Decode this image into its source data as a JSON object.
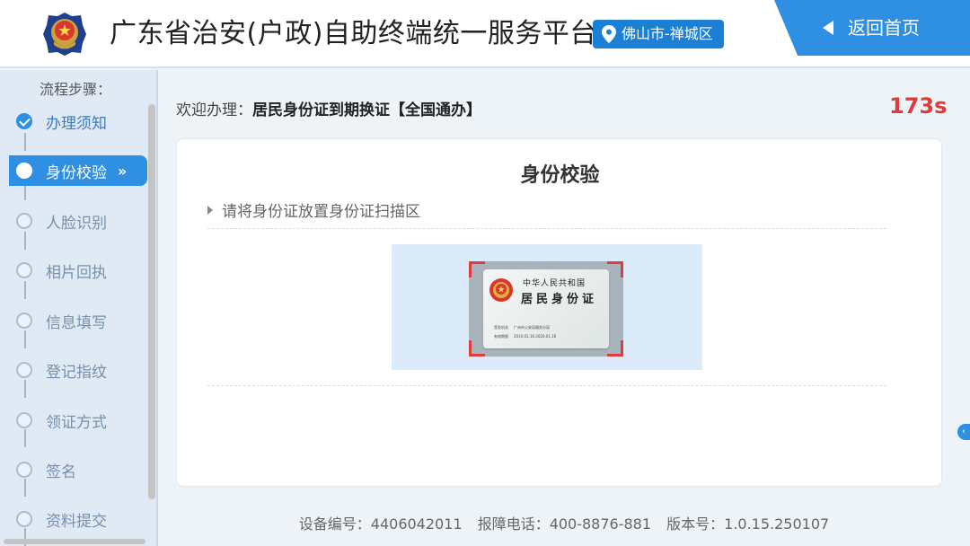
{
  "header": {
    "title": "广东省治安(户政)自助终端统一服务平台",
    "location": "佛山市-禅城区",
    "back_label": "返回首页"
  },
  "sidebar": {
    "title": "流程步骤：",
    "steps": [
      {
        "label": "办理须知",
        "state": "done"
      },
      {
        "label": "身份校验",
        "state": "active"
      },
      {
        "label": "人脸识别",
        "state": "pending"
      },
      {
        "label": "相片回执",
        "state": "pending"
      },
      {
        "label": "信息填写",
        "state": "pending"
      },
      {
        "label": "登记指纹",
        "state": "pending"
      },
      {
        "label": "领证方式",
        "state": "pending"
      },
      {
        "label": "签名",
        "state": "pending"
      },
      {
        "label": "资料提交",
        "state": "pending"
      }
    ],
    "active_chevron": "»"
  },
  "main": {
    "welcome_prefix": "欢迎办理：",
    "service_name": "居民身份证到期换证【全国通办】",
    "countdown": "173s",
    "card_title": "身份校验",
    "instruction": "请将身份证放置身份证扫描区"
  },
  "id_card": {
    "country": "中华人民共和国",
    "name": "居民身份证",
    "authority_label": "签发机关",
    "authority_value": "广州市公安局服务分局",
    "validity_label": "有效期限",
    "validity_value": "2010.01.16-2020.01.16"
  },
  "footer": {
    "device": "设备编号：4406042011",
    "hotline": "报障电话：400-8876-881",
    "version": "版本号：1.0.15.250107"
  },
  "side_toggle": "‹",
  "colors": {
    "primary": "#2f8fe2",
    "countdown": "#e03a3a",
    "sidebar_bg": "#dfeaf5",
    "scan_corner": "#e23b3b"
  }
}
